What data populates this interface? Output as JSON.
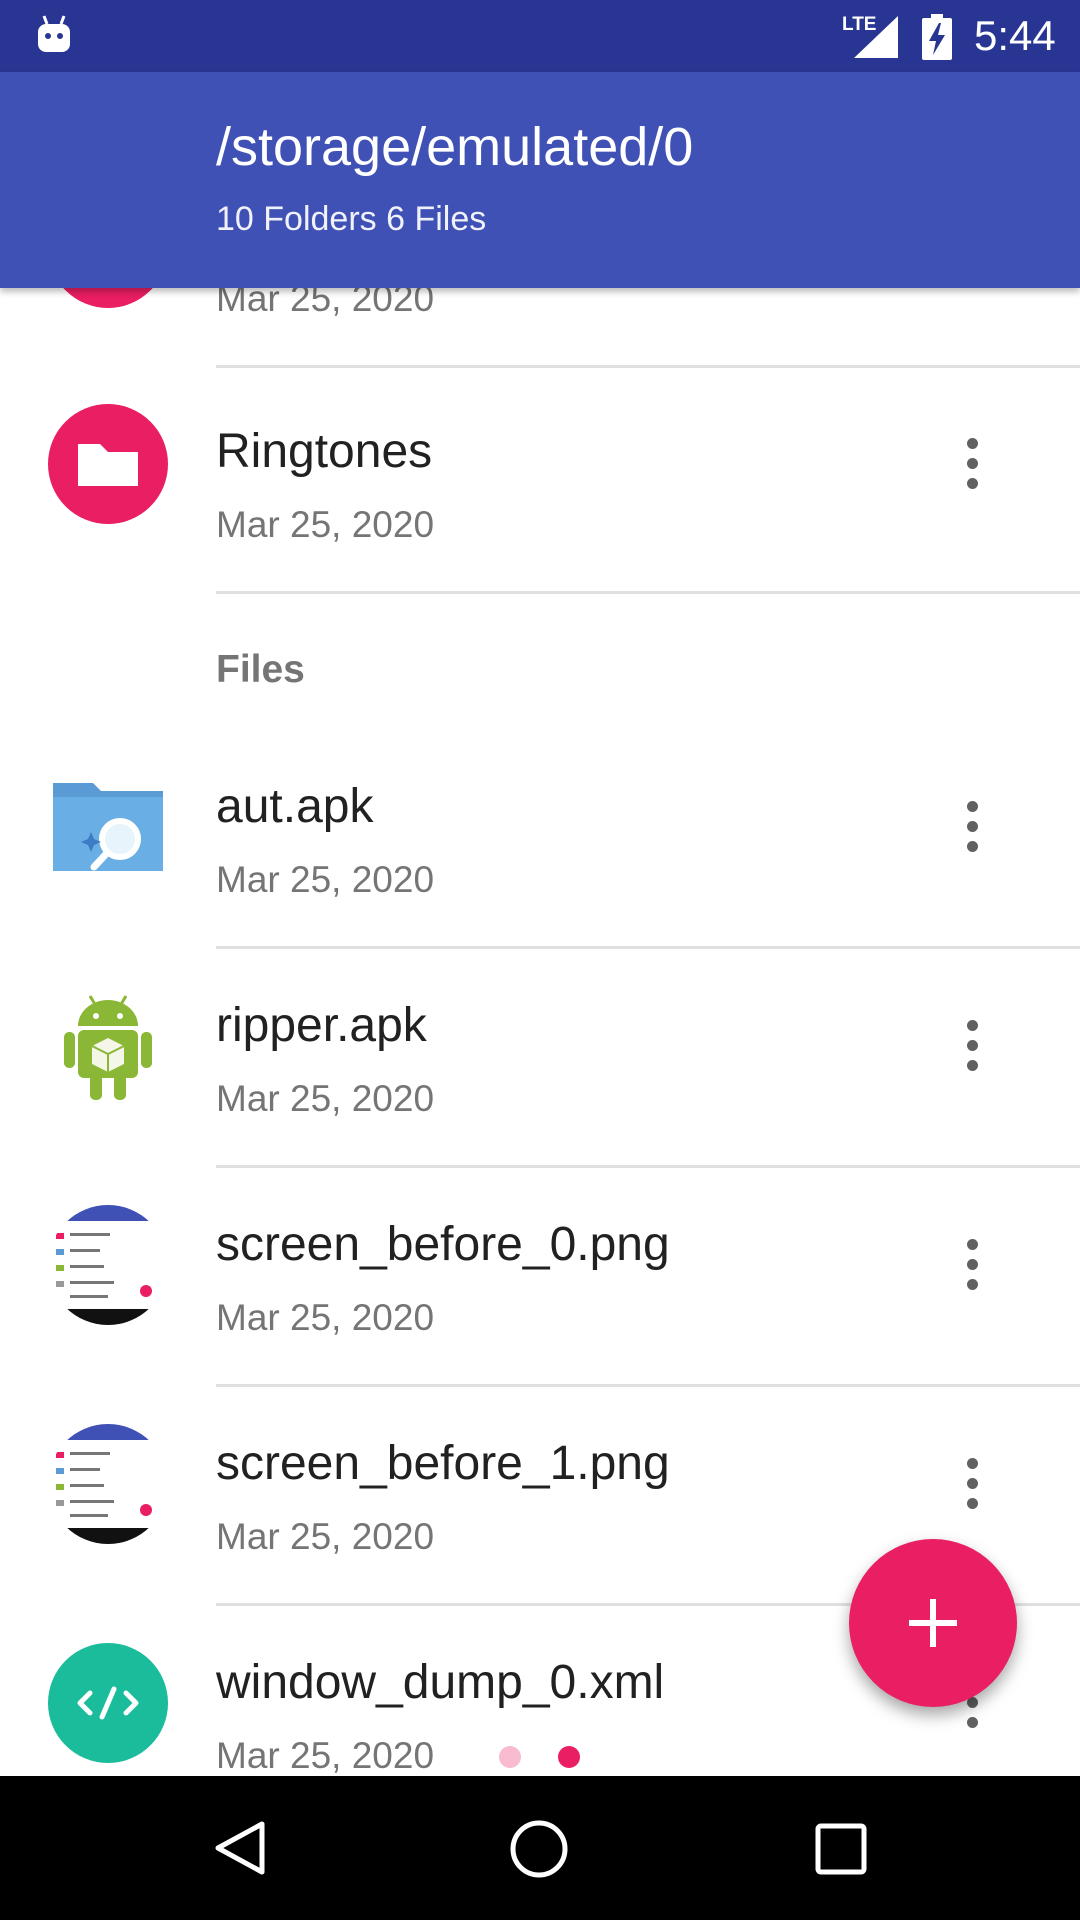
{
  "status_bar": {
    "network": "LTE",
    "time": "5:44",
    "background": "#283593"
  },
  "app_bar": {
    "title": "/storage/emulated/0",
    "subtitle": "10 Folders 6 Files",
    "background": "#3f51b5"
  },
  "folders": [
    {
      "name": "",
      "date": "Mar 25, 2020",
      "icon": "folder-icon"
    },
    {
      "name": "Ringtones",
      "date": "Mar 25, 2020",
      "icon": "folder-icon"
    }
  ],
  "files_section": {
    "label": "Files"
  },
  "files": [
    {
      "name": "aut.apk",
      "date": "Mar 25, 2020",
      "icon": "file-search-icon"
    },
    {
      "name": "ripper.apk",
      "date": "Mar 25, 2020",
      "icon": "android-package-icon"
    },
    {
      "name": "screen_before_0.png",
      "date": "Mar 25, 2020",
      "icon": "image-thumbnail"
    },
    {
      "name": "screen_before_1.png",
      "date": "Mar 25, 2020",
      "icon": "image-thumbnail"
    },
    {
      "name": "window_dump_0.xml",
      "date": "Mar 25, 2020",
      "icon": "code-icon"
    }
  ],
  "fab": {
    "icon": "plus-icon",
    "color": "#e91e63"
  },
  "page_indicator": {
    "count": 2,
    "active": 2
  },
  "nav_bar": {
    "back": "back-icon",
    "home": "home-icon",
    "recents": "recents-icon"
  }
}
